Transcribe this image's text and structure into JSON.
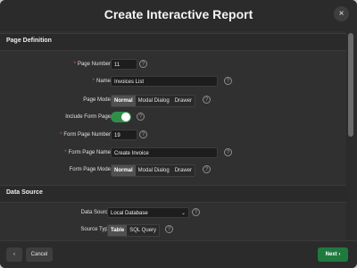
{
  "dialog": {
    "title": "Create Interactive Report",
    "close_icon": "×"
  },
  "sections": {
    "page_definition": "Page Definition",
    "data_source": "Data Source"
  },
  "fields": {
    "page_number": {
      "label": "Page Number",
      "value": "11",
      "required": true
    },
    "name": {
      "label": "Name",
      "value": "Invoices List",
      "required": true
    },
    "page_mode": {
      "label": "Page Mode",
      "options": [
        "Normal",
        "Modal Dialog",
        "Drawer"
      ],
      "selected": "Normal"
    },
    "include_form_page": {
      "label": "Include Form Page",
      "enabled": true
    },
    "form_page_number": {
      "label": "Form Page Number",
      "value": "19",
      "required": true
    },
    "form_page_name": {
      "label": "Form Page Name",
      "value": "Create Invoice",
      "required": true
    },
    "form_page_mode": {
      "label": "Form Page Mode",
      "options": [
        "Normal",
        "Modal Dialog",
        "Drawer"
      ],
      "selected": "Normal"
    },
    "data_source": {
      "label": "Data Source",
      "value": "Local Database"
    },
    "source_type": {
      "label": "Source Type",
      "options": [
        "Table",
        "SQL Query"
      ],
      "selected": "Table"
    }
  },
  "help_icon": "?",
  "footer": {
    "prev_icon": "‹",
    "cancel_label": "Cancel",
    "next_label": "Next",
    "next_icon": "›"
  },
  "colors": {
    "primary_button": "#1f7a3e",
    "toggle_on": "#2f8f4a",
    "required_marker": "#e05c5c"
  }
}
